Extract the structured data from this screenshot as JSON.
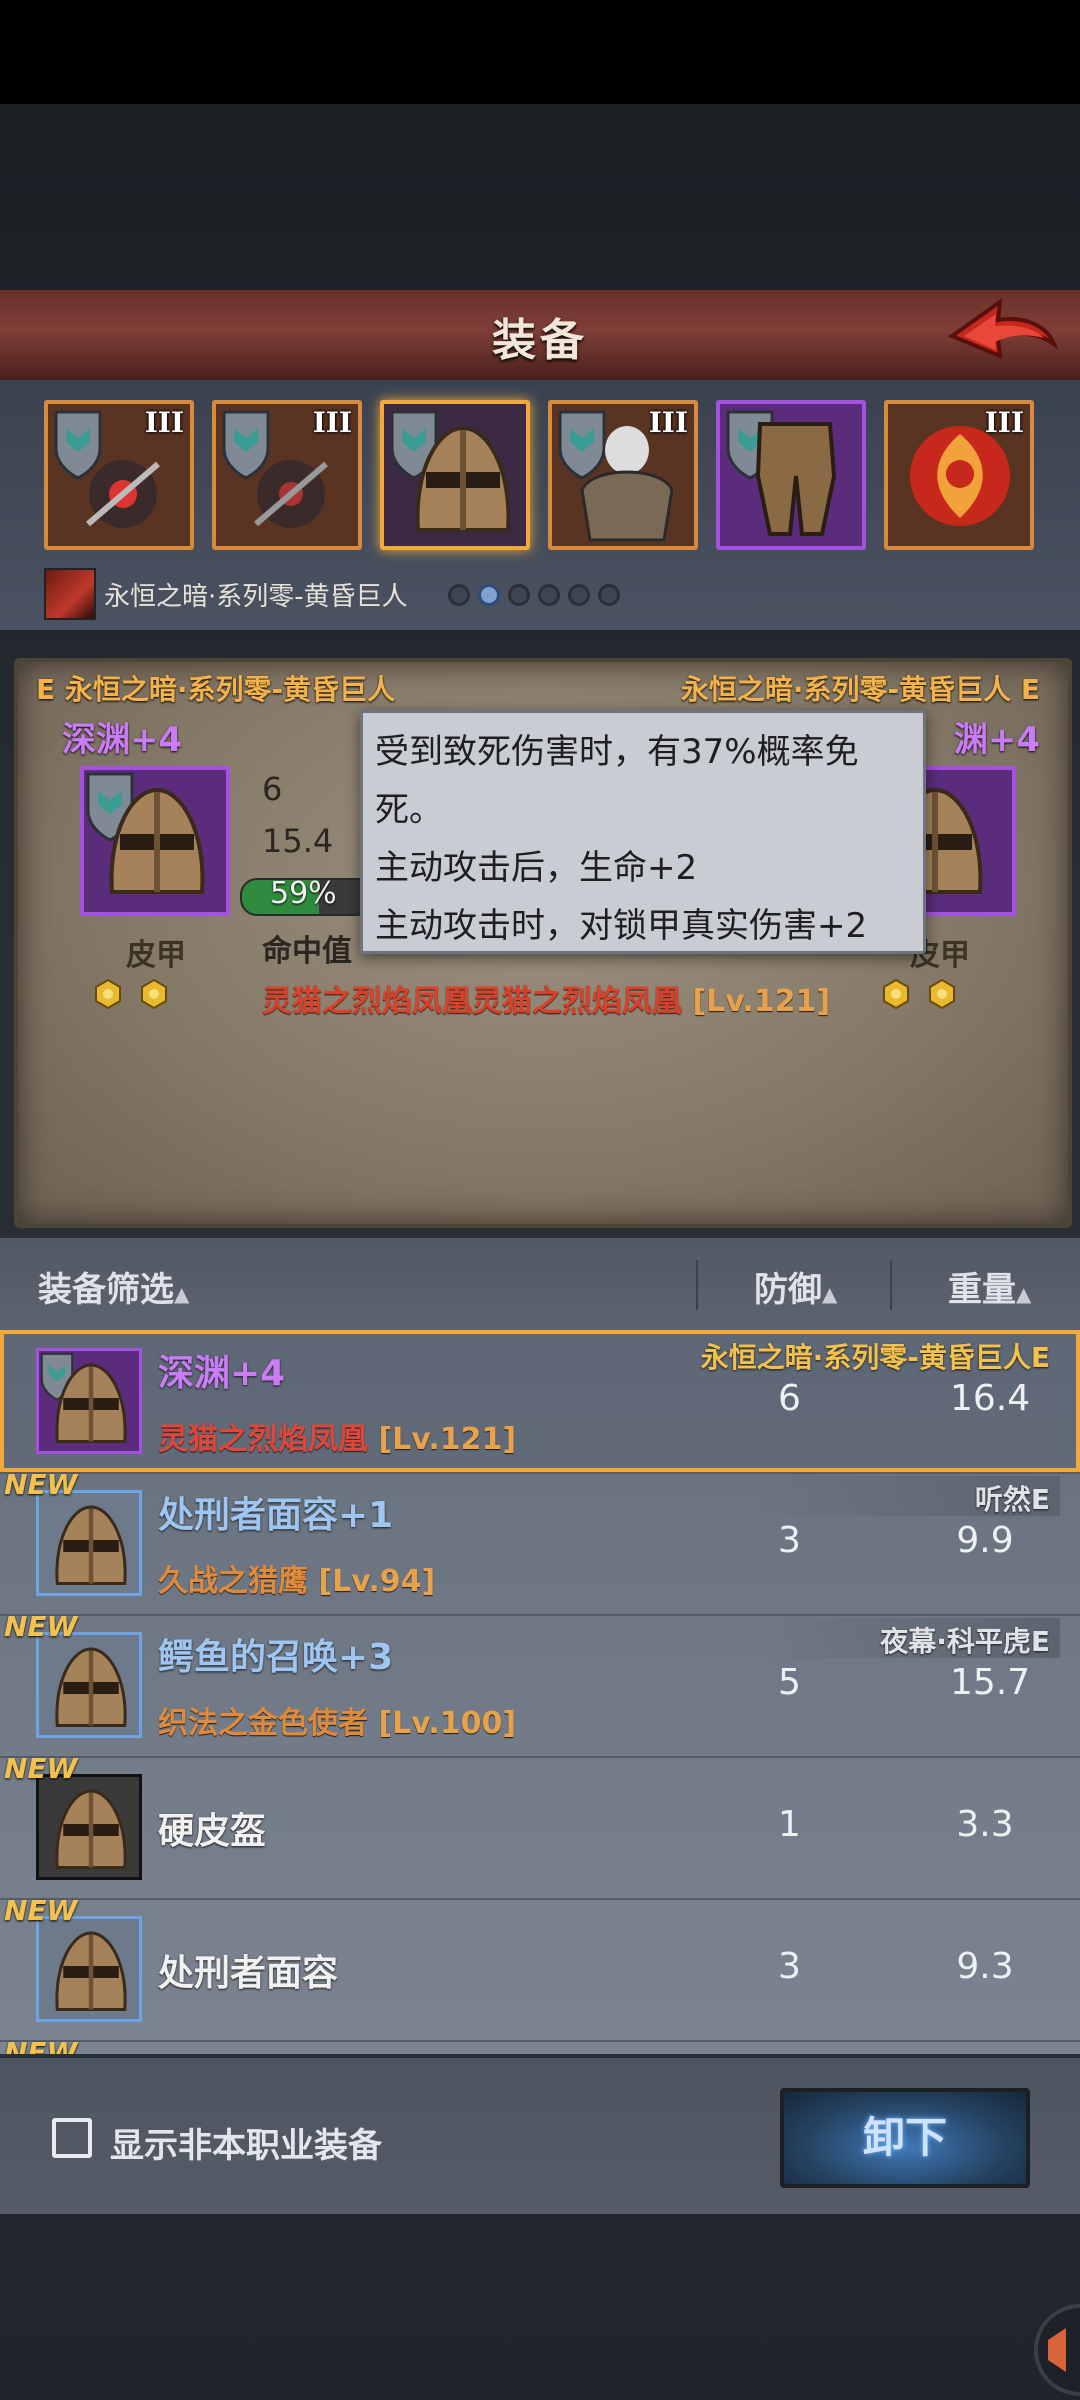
{
  "header": {
    "title": "装备"
  },
  "slots": [
    {
      "tier": "III"
    },
    {
      "tier": "III"
    },
    {
      "tier": ""
    },
    {
      "tier": "III"
    },
    {
      "tier": ""
    },
    {
      "tier": "III"
    }
  ],
  "set_row": {
    "name": "永恒之暗·系列零-黄昏巨人"
  },
  "compare": {
    "left_tag": "E 永恒之暗·系列零-黄昏巨人",
    "right_tag": "永恒之暗·系列零-黄昏巨人 E",
    "left_name": "深渊+4",
    "right_name": "渊+4",
    "left_type": "皮甲",
    "right_type": "皮甲",
    "stat_defense": "6",
    "stat_weight": "15.4",
    "percent_text": "59%",
    "percent_value": 0.59,
    "hit_label": "命中值",
    "effect_name": "灵猫之烈焰凤凰灵猫之烈焰凤凰",
    "effect_level": "[Lv.121]"
  },
  "tooltip": {
    "line1": "受到致死伤害时，有37%概率免死。",
    "line2": "主动攻击后，生命+2",
    "line3": "主动攻击时，对锁甲真实伤害+2"
  },
  "list_header": {
    "filter": "装备筛选",
    "defense": "防御",
    "weight": "重量",
    "caret": "▲"
  },
  "items": [
    {
      "new": "",
      "name": "深渊+4",
      "effect": "灵猫之烈焰凤凰",
      "level": "[Lv.121]",
      "owner": "永恒之暗·系列零-黄昏巨人E",
      "defense": "6",
      "weight": "16.4"
    },
    {
      "new": "NEW",
      "name": "处刑者面容+1",
      "effect": "久战之猎鹰",
      "level": "[Lv.94]",
      "owner": "听然E",
      "defense": "3",
      "weight": "9.9"
    },
    {
      "new": "NEW",
      "name": "鳄鱼的召唤+3",
      "effect": "织法之金色使者",
      "level": "[Lv.100]",
      "owner": "夜幕·科平虎E",
      "defense": "5",
      "weight": "15.7"
    },
    {
      "new": "NEW",
      "name": "硬皮盔",
      "effect": "",
      "level": "",
      "owner": "",
      "defense": "1",
      "weight": "3.3"
    },
    {
      "new": "NEW",
      "name": "处刑者面容",
      "effect": "",
      "level": "",
      "owner": "",
      "defense": "3",
      "weight": "9.3"
    },
    {
      "new": "NEW"
    }
  ],
  "bottom": {
    "checkbox_label": "显示非本职业装备",
    "unequip": "卸下"
  },
  "colors": {
    "accent_orange": "#f0a93a",
    "epic_purple": "#a450e0",
    "rare_blue": "#6ea4e6",
    "header_red": "#6b2f2a"
  }
}
